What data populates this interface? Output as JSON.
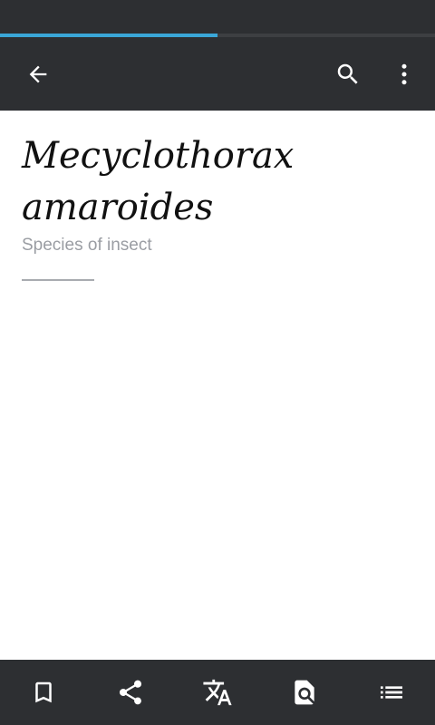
{
  "status_bar": {
    "background": "#2d2f32"
  },
  "page_load_progress": {
    "fraction": 0.5,
    "fill_color": "#3aa7d8"
  },
  "toolbar": {
    "background": "#2d2f32",
    "back_icon": "arrow-back-icon",
    "search_icon": "search-icon",
    "menu_icon": "more-vertical-icon"
  },
  "article": {
    "title": "Mecyclothorax amaroides",
    "description": "Species of insect"
  },
  "bottom_bar": {
    "items": [
      {
        "icon": "bookmark-icon"
      },
      {
        "icon": "share-icon"
      },
      {
        "icon": "translate-icon"
      },
      {
        "icon": "find-in-page-icon"
      },
      {
        "icon": "table-of-contents-icon"
      }
    ]
  },
  "colors": {
    "icon": "#ffffff",
    "title_text": "#111111",
    "description_text": "#9a9da3"
  }
}
